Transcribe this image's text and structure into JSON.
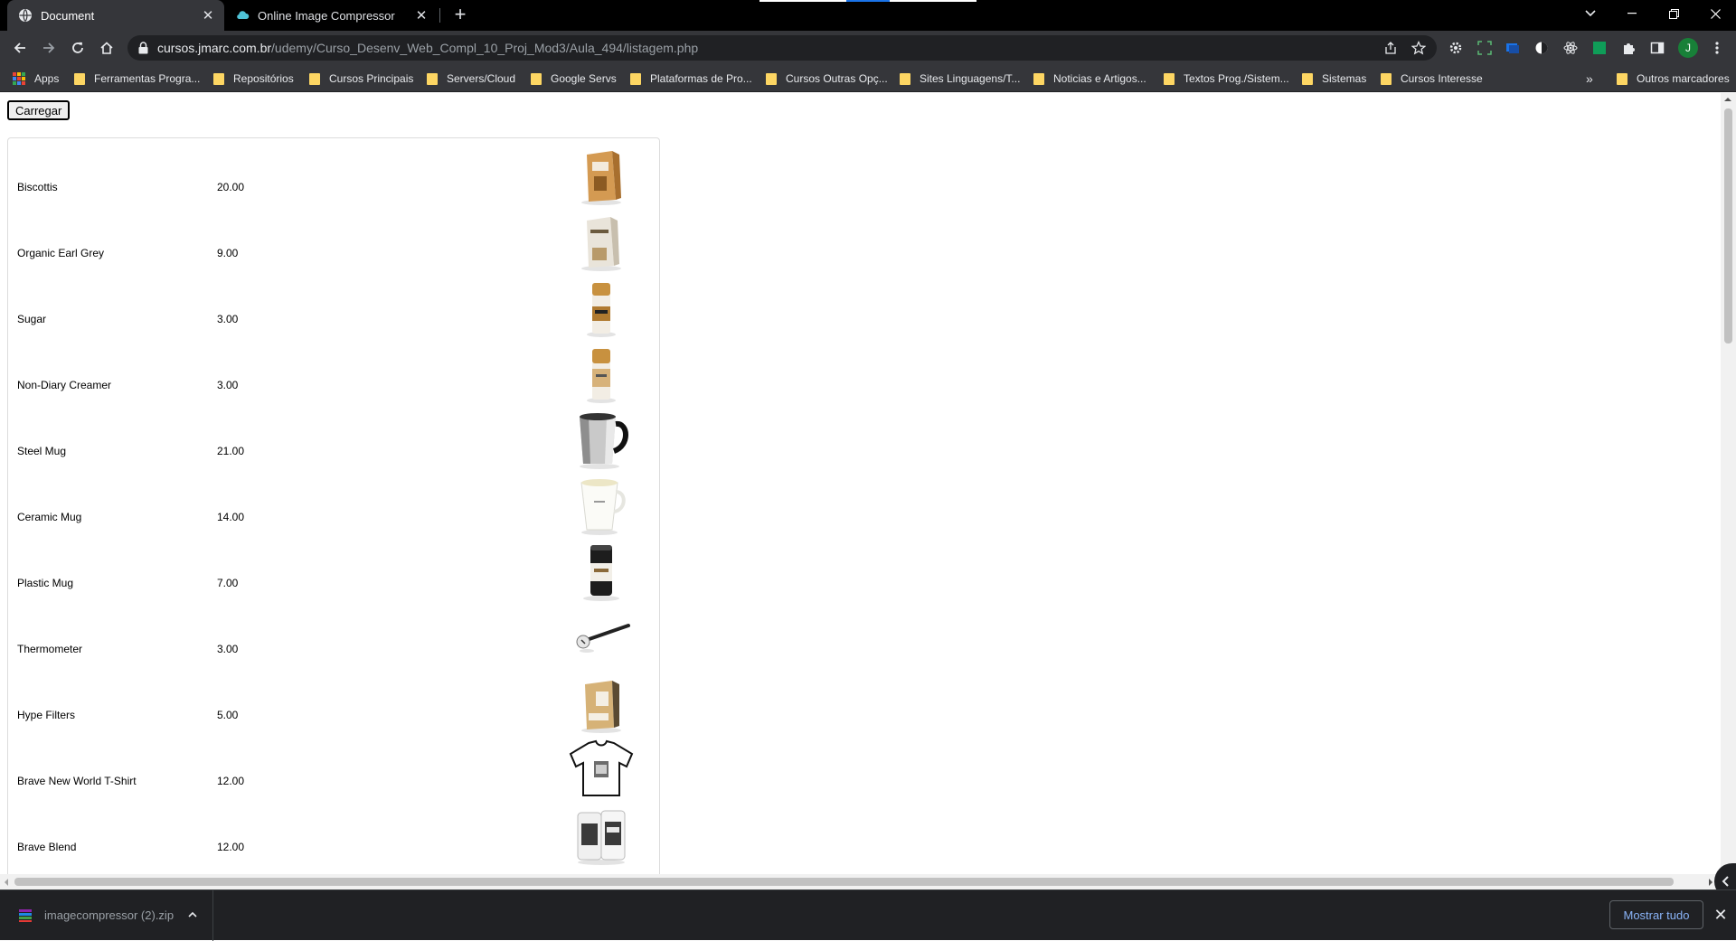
{
  "browser": {
    "tabs": [
      {
        "title": "Document",
        "icon": "globe-icon",
        "active": true
      },
      {
        "title": "Online Image Compressor",
        "icon": "cloud-icon",
        "active": false
      }
    ],
    "url": {
      "host": "cursos.jmarc.com.br",
      "path": "/udemy/Curso_Desenv_Web_Compl_10_Proj_Mod3/Aula_494/listagem.php"
    },
    "profile_initial": "J",
    "bookmarks": [
      "Apps",
      "Ferramentas Progra...",
      "Repositórios",
      "Cursos Principais",
      "Servers/Cloud",
      "Google Servs",
      "Plataformas de Pro...",
      "Cursos Outras Opç...",
      "Sites Linguagens/T...",
      "Noticias e Artigos...",
      "Textos Prog./Sistem...",
      "Sistemas",
      "Cursos Interesse"
    ],
    "bookmarks_overflow": "»",
    "other_bookmarks": "Outros marcadores",
    "colors": {
      "chrome_dark": "#35363a",
      "tabstrip": "#000000",
      "folder": "#fdd663",
      "link_blue": "#8ab4f8",
      "avatar": "#188038"
    }
  },
  "page": {
    "load_button": "Carregar",
    "products": [
      {
        "name": "Biscottis",
        "price": "20.00",
        "image": "biscotti-box"
      },
      {
        "name": "Organic Earl Grey",
        "price": "9.00",
        "image": "tea-box"
      },
      {
        "name": "Sugar",
        "price": "3.00",
        "image": "sugar-jar"
      },
      {
        "name": "Non-Diary Creamer",
        "price": "3.00",
        "image": "creamer-jar"
      },
      {
        "name": "Steel Mug",
        "price": "21.00",
        "image": "steel-mug"
      },
      {
        "name": "Ceramic Mug",
        "price": "14.00",
        "image": "ceramic-mug"
      },
      {
        "name": "Plastic Mug",
        "price": "7.00",
        "image": "plastic-mug"
      },
      {
        "name": "Thermometer",
        "price": "3.00",
        "image": "thermometer"
      },
      {
        "name": "Hype Filters",
        "price": "5.00",
        "image": "filters-box"
      },
      {
        "name": "Brave New World T-Shirt",
        "price": "12.00",
        "image": "t-shirt"
      },
      {
        "name": "Brave Blend",
        "price": "12.00",
        "image": "coffee-cans"
      }
    ]
  },
  "downloads": {
    "file_name": "imagecompressor (2).zip",
    "show_all": "Mostrar tudo"
  }
}
